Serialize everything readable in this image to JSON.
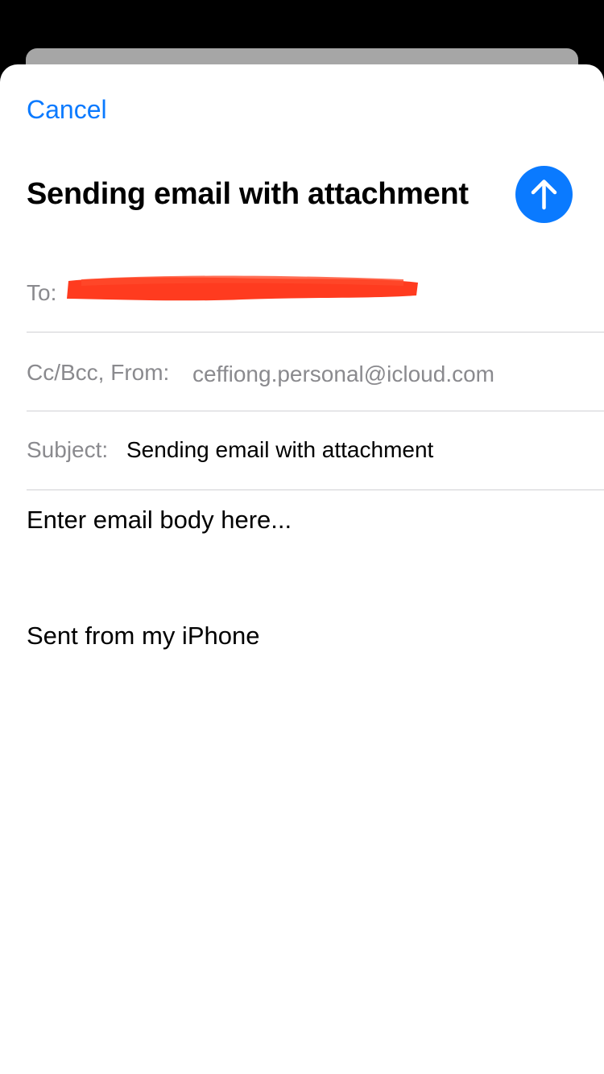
{
  "compose": {
    "cancel_label": "Cancel",
    "title": "Sending email with attachment",
    "send_icon": "arrow-up-icon",
    "to_label": "To:",
    "cc_from_label": "Cc/Bcc, From:",
    "from_value": "ceffiong.personal@icloud.com",
    "subject_label": "Subject:",
    "subject_value": "Sending email with attachment",
    "body_placeholder": "Enter email body here...",
    "signature": "Sent from my iPhone"
  },
  "colors": {
    "accent": "#0a7aff",
    "redaction": "#ff3b1f",
    "label_gray": "#8a8a8e"
  }
}
